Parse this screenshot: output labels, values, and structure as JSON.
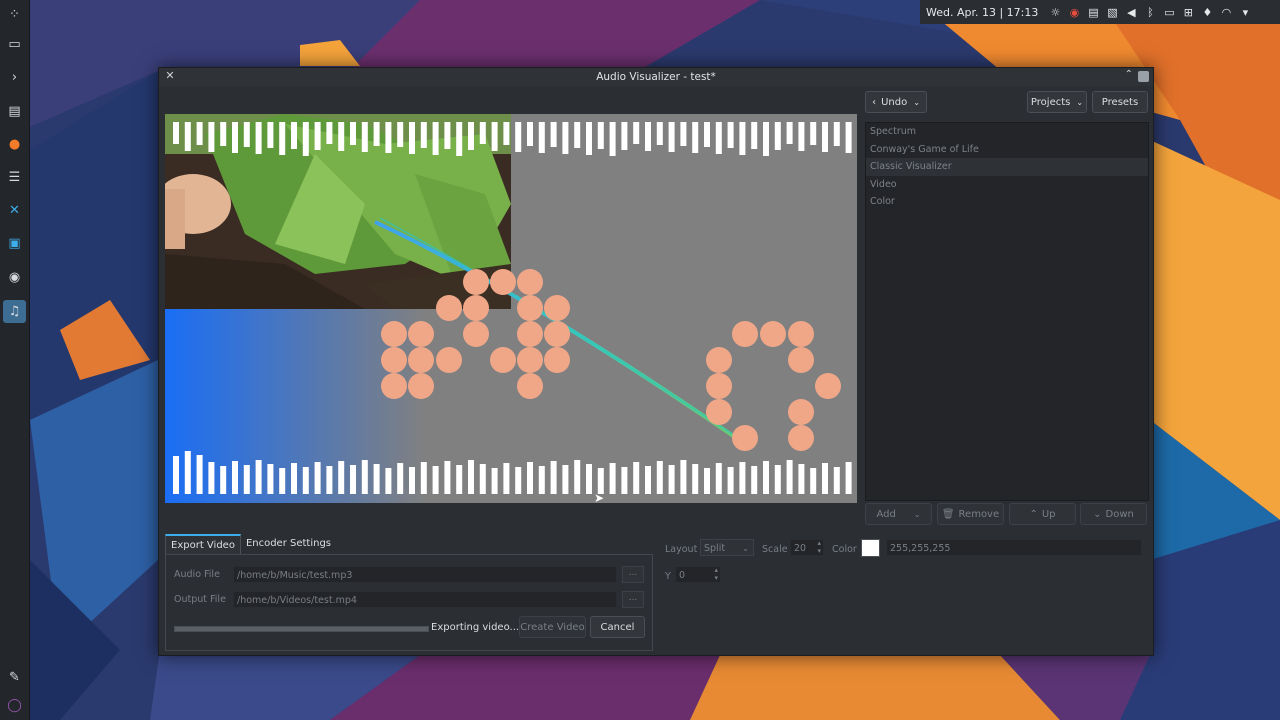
{
  "tray": {
    "clock": "Wed. Apr. 13 | 17:13"
  },
  "window": {
    "title": "Audio Visualizer - test*"
  },
  "toolbar": {
    "undo_label": "Undo",
    "projects_label": "Projects",
    "presets_label": "Presets"
  },
  "layers": [
    {
      "label": "Spectrum"
    },
    {
      "label": "Conway's Game of Life"
    },
    {
      "label": "Classic Visualizer"
    },
    {
      "label": "Video"
    },
    {
      "label": "Color"
    }
  ],
  "layer_actions": {
    "add": "Add",
    "remove": "Remove",
    "up": "Up",
    "down": "Down"
  },
  "tabs": {
    "export": "Export Video",
    "encoder": "Encoder Settings"
  },
  "export": {
    "audio_label": "Audio File",
    "audio_value": "/home/b/Music/test.mp3",
    "output_label": "Output File",
    "output_value": "/home/b/Videos/test.mp4",
    "browse": "...",
    "status": "Exporting video...",
    "create": "Create Video",
    "cancel": "Cancel"
  },
  "component_settings": {
    "layout_label": "Layout",
    "layout_value": "Split",
    "scale_label": "Scale",
    "scale_value": "20",
    "color_label": "Color",
    "color_value": "255,255,255",
    "color_swatch": "#ffffff",
    "y_label": "Y",
    "y_value": "0"
  },
  "colors": {
    "accent": "#3daee9",
    "cell": "#f0a788",
    "preview_bg": "#808080",
    "gradient_blue": "#1a6ef5"
  }
}
